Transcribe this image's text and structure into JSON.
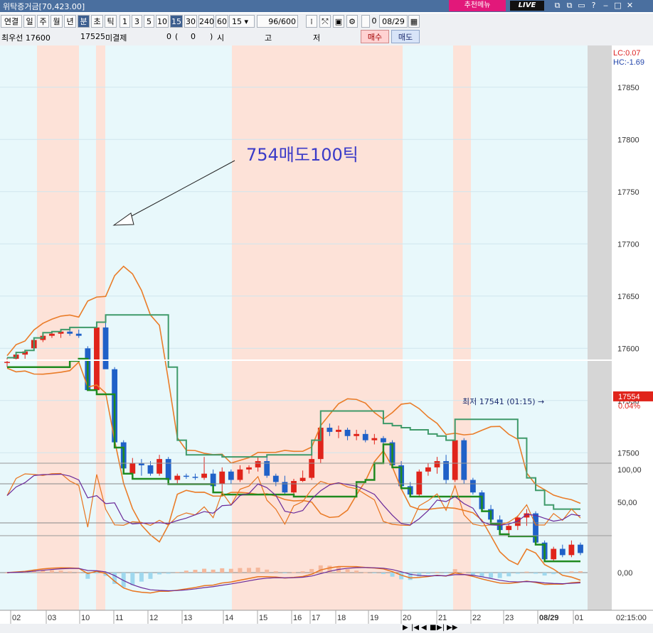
{
  "window": {
    "title": "위탁증거금[70,423.00]",
    "promo_button": "추천메뉴",
    "live_badge": "LIVE",
    "controls": [
      "⧉",
      "⧉",
      "▭",
      "?",
      "‒",
      "□",
      "✕"
    ]
  },
  "toolbar": {
    "left_buttons": [
      "연결",
      "일",
      "주",
      "월",
      "년",
      "분",
      "초",
      "틱"
    ],
    "active_period": "분",
    "interval_buttons": [
      "1",
      "3",
      "5",
      "10",
      "15",
      "30",
      "240",
      "60"
    ],
    "active_interval": "15",
    "interval_select": "15",
    "count_value": "96",
    "count_total": "/600",
    "date_value": "08/29",
    "checkbox_label": "0"
  },
  "info_bar": {
    "label_1": "최우선 17600",
    "label_2": "17525",
    "label_3": "미결제",
    "label_4": "0",
    "label_5": "(",
    "label_6": "0",
    "label_7": ")",
    "label_8": "시",
    "label_9": "고",
    "label_10": "저",
    "buy_button": "매수",
    "sell_button": "매도"
  },
  "chart_data": {
    "type": "candlestick",
    "price_axis_labels": [
      "17850",
      "17800",
      "17750",
      "17700",
      "17650",
      "17600",
      "17550",
      "17500"
    ],
    "lc_label": "LC:0.07",
    "hc_label": "HC:-1.69",
    "current_price": "17554",
    "current_change": "0.04%",
    "annotation_text": "754매도100틱",
    "low_label": "최저 17541 (01:15)",
    "ylim": [
      17490,
      17890
    ],
    "indicator1_labels": [
      "100,00",
      "50,00"
    ],
    "indicator2_label": "0,00",
    "time_axis_labels": [
      "02",
      "03",
      "10",
      "11",
      "12",
      "13",
      "14",
      "15",
      "16",
      "17",
      "18",
      "19",
      "20",
      "21",
      "22",
      "23",
      "08/29",
      "01",
      "02"
    ],
    "time_axis_right": "02:15:00",
    "candles": [
      {
        "o": 17587,
        "h": 17591,
        "l": 17582,
        "c": 17587
      },
      {
        "o": 17590,
        "h": 17596,
        "l": 17588,
        "c": 17594
      },
      {
        "o": 17594,
        "h": 17598,
        "l": 17590,
        "c": 17597
      },
      {
        "o": 17600,
        "h": 17610,
        "l": 17598,
        "c": 17608
      },
      {
        "o": 17608,
        "h": 17615,
        "l": 17606,
        "c": 17612
      },
      {
        "o": 17612,
        "h": 17616,
        "l": 17610,
        "c": 17614
      },
      {
        "o": 17614,
        "h": 17618,
        "l": 17610,
        "c": 17616
      },
      {
        "o": 17616,
        "h": 17620,
        "l": 17612,
        "c": 17614
      },
      {
        "o": 17614,
        "h": 17618,
        "l": 17610,
        "c": 17612
      },
      {
        "o": 17600,
        "h": 17602,
        "l": 17560,
        "c": 17560
      },
      {
        "o": 17560,
        "h": 17625,
        "l": 17556,
        "c": 17620
      },
      {
        "o": 17620,
        "h": 17632,
        "l": 17610,
        "c": 17580
      },
      {
        "o": 17580,
        "h": 17582,
        "l": 17505,
        "c": 17510
      },
      {
        "o": 17510,
        "h": 17512,
        "l": 17480,
        "c": 17485
      },
      {
        "o": 17480,
        "h": 17495,
        "l": 17475,
        "c": 17490
      },
      {
        "o": 17490,
        "h": 17494,
        "l": 17478,
        "c": 17488
      },
      {
        "o": 17488,
        "h": 17492,
        "l": 17478,
        "c": 17480
      },
      {
        "o": 17480,
        "h": 17498,
        "l": 17478,
        "c": 17494
      },
      {
        "o": 17494,
        "h": 17496,
        "l": 17470,
        "c": 17474
      },
      {
        "o": 17474,
        "h": 17480,
        "l": 17470,
        "c": 17478
      },
      {
        "o": 17478,
        "h": 17480,
        "l": 17475,
        "c": 17477
      },
      {
        "o": 17477,
        "h": 17480,
        "l": 17474,
        "c": 17476
      },
      {
        "o": 17476,
        "h": 17496,
        "l": 17474,
        "c": 17480
      },
      {
        "o": 17480,
        "h": 17484,
        "l": 17462,
        "c": 17468
      },
      {
        "o": 17470,
        "h": 17486,
        "l": 17460,
        "c": 17482
      },
      {
        "o": 17482,
        "h": 17484,
        "l": 17470,
        "c": 17474
      },
      {
        "o": 17474,
        "h": 17488,
        "l": 17472,
        "c": 17484
      },
      {
        "o": 17484,
        "h": 17488,
        "l": 17480,
        "c": 17486
      },
      {
        "o": 17486,
        "h": 17496,
        "l": 17482,
        "c": 17492
      },
      {
        "o": 17492,
        "h": 17498,
        "l": 17476,
        "c": 17478
      },
      {
        "o": 17478,
        "h": 17480,
        "l": 17468,
        "c": 17472
      },
      {
        "o": 17472,
        "h": 17478,
        "l": 17460,
        "c": 17462
      },
      {
        "o": 17462,
        "h": 17475,
        "l": 17458,
        "c": 17473
      },
      {
        "o": 17473,
        "h": 17483,
        "l": 17472,
        "c": 17476
      },
      {
        "o": 17476,
        "h": 17512,
        "l": 17474,
        "c": 17494
      },
      {
        "o": 17494,
        "h": 17540,
        "l": 17490,
        "c": 17524
      },
      {
        "o": 17524,
        "h": 17528,
        "l": 17516,
        "c": 17520
      },
      {
        "o": 17520,
        "h": 17526,
        "l": 17514,
        "c": 17522
      },
      {
        "o": 17522,
        "h": 17524,
        "l": 17512,
        "c": 17516
      },
      {
        "o": 17516,
        "h": 17522,
        "l": 17512,
        "c": 17518
      },
      {
        "o": 17518,
        "h": 17522,
        "l": 17510,
        "c": 17512
      },
      {
        "o": 17512,
        "h": 17518,
        "l": 17508,
        "c": 17514
      },
      {
        "o": 17514,
        "h": 17516,
        "l": 17508,
        "c": 17510
      },
      {
        "o": 17510,
        "h": 17512,
        "l": 17486,
        "c": 17488
      },
      {
        "o": 17488,
        "h": 17492,
        "l": 17466,
        "c": 17468
      },
      {
        "o": 17468,
        "h": 17472,
        "l": 17458,
        "c": 17460
      },
      {
        "o": 17460,
        "h": 17484,
        "l": 17458,
        "c": 17482
      },
      {
        "o": 17482,
        "h": 17490,
        "l": 17478,
        "c": 17486
      },
      {
        "o": 17486,
        "h": 17496,
        "l": 17480,
        "c": 17492
      },
      {
        "o": 17492,
        "h": 17498,
        "l": 17470,
        "c": 17474
      },
      {
        "o": 17474,
        "h": 17532,
        "l": 17472,
        "c": 17512
      },
      {
        "o": 17512,
        "h": 17514,
        "l": 17470,
        "c": 17474
      },
      {
        "o": 17474,
        "h": 17476,
        "l": 17460,
        "c": 17462
      },
      {
        "o": 17462,
        "h": 17464,
        "l": 17444,
        "c": 17446
      },
      {
        "o": 17446,
        "h": 17450,
        "l": 17432,
        "c": 17436
      },
      {
        "o": 17436,
        "h": 17440,
        "l": 17422,
        "c": 17426
      },
      {
        "o": 17426,
        "h": 17432,
        "l": 17420,
        "c": 17430
      },
      {
        "o": 17430,
        "h": 17440,
        "l": 17426,
        "c": 17438
      },
      {
        "o": 17438,
        "h": 17446,
        "l": 17430,
        "c": 17442
      },
      {
        "o": 17442,
        "h": 17444,
        "l": 17412,
        "c": 17414
      },
      {
        "o": 17414,
        "h": 17416,
        "l": 17396,
        "c": 17398
      },
      {
        "o": 17398,
        "h": 17410,
        "l": 17396,
        "c": 17408
      },
      {
        "o": 17408,
        "h": 17412,
        "l": 17400,
        "c": 17402
      },
      {
        "o": 17402,
        "h": 17416,
        "l": 17400,
        "c": 17412
      },
      {
        "o": 17412,
        "h": 17414,
        "l": 17402,
        "c": 17404
      }
    ]
  },
  "scrollbar": {
    "buttons": [
      "▶",
      "|◀",
      "◀",
      "■",
      "▶|",
      "▶▶"
    ]
  }
}
